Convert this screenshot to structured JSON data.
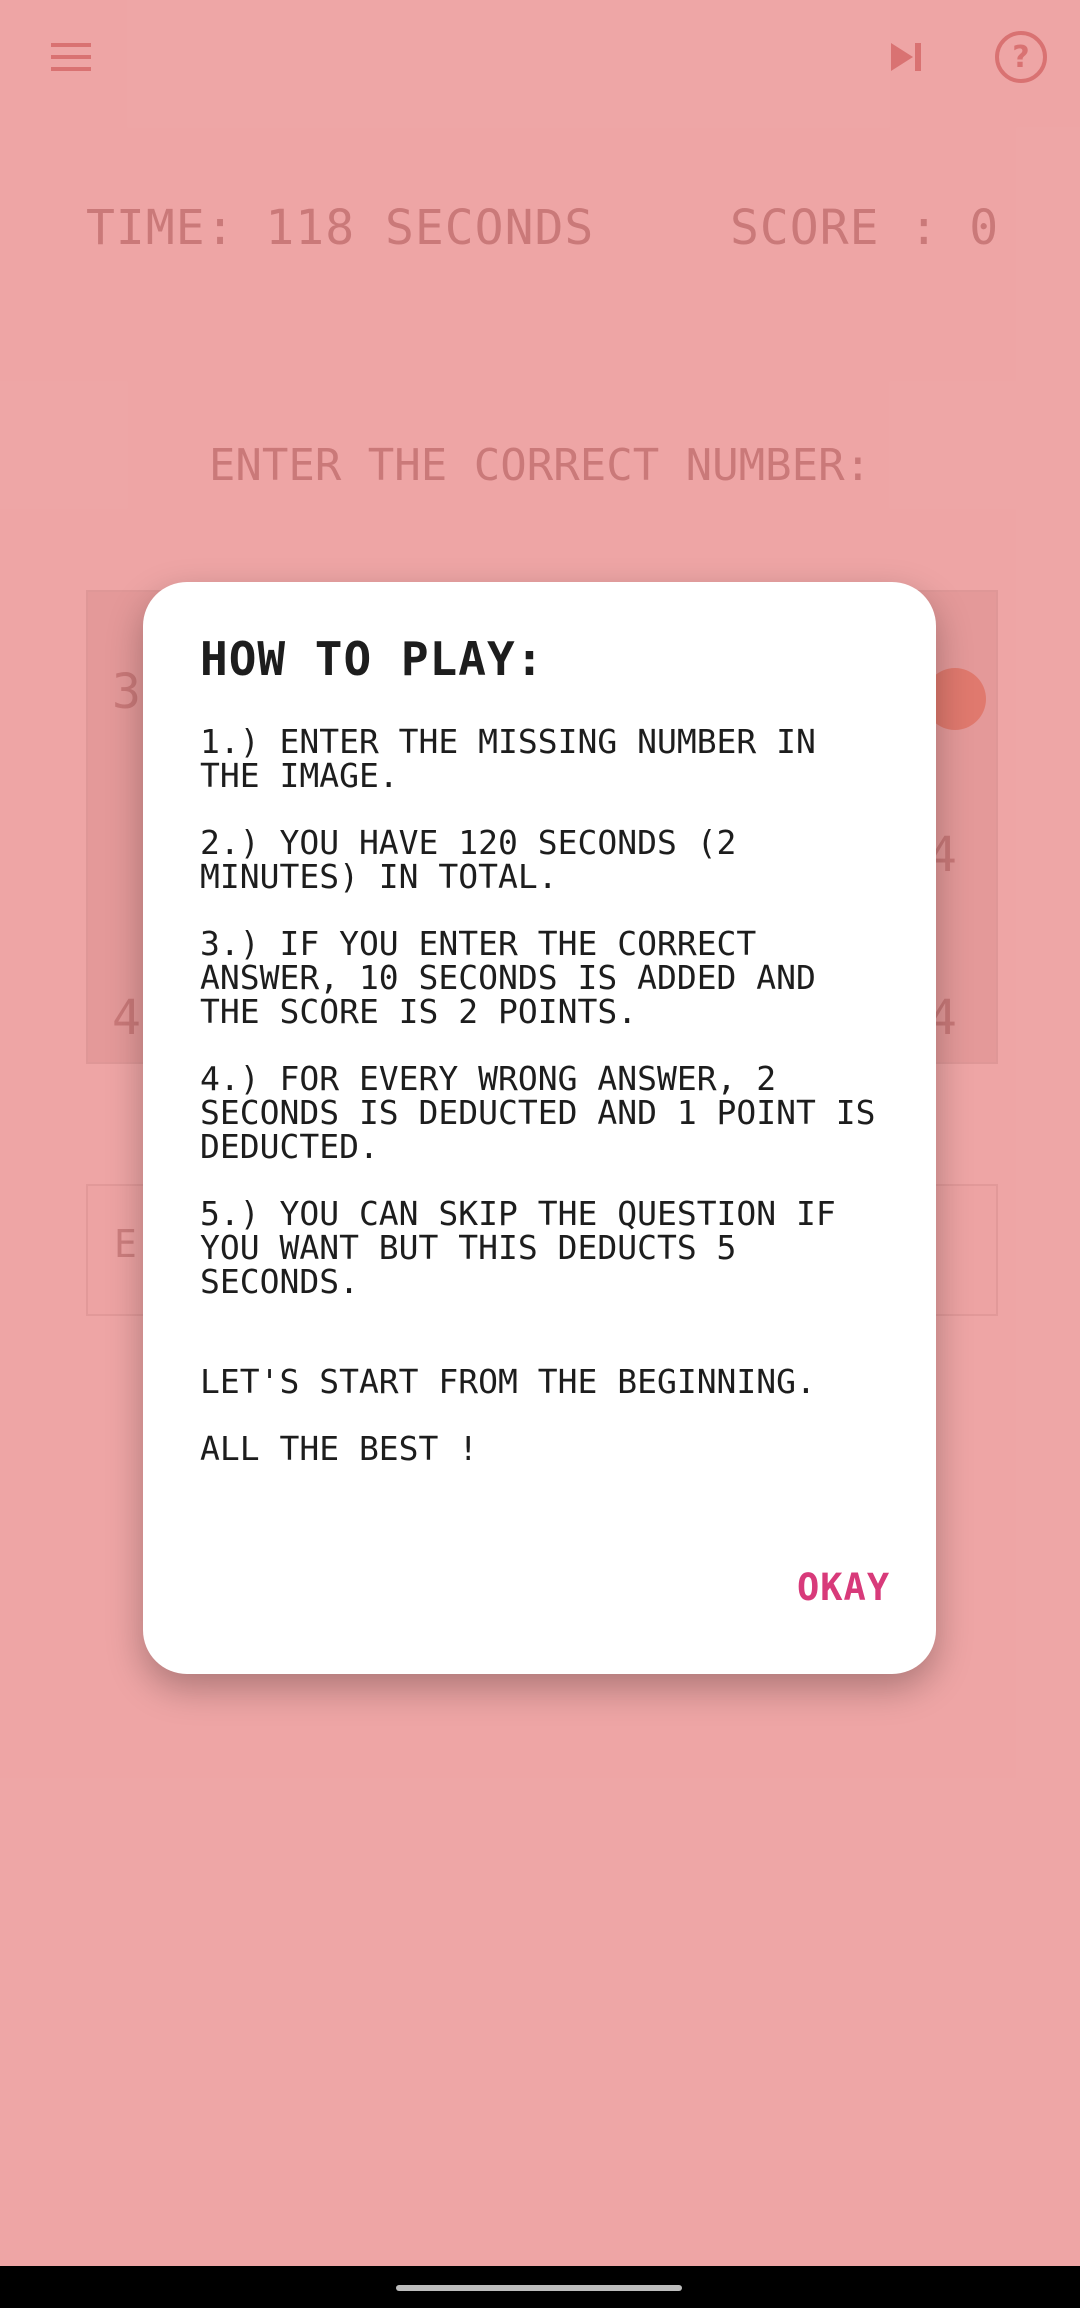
{
  "header": {
    "menu_icon": "hamburger-menu-icon",
    "skip_icon": "skip-next-icon",
    "help_icon": "help-icon",
    "help_glyph": "?"
  },
  "hud": {
    "time": "TIME: 118 SECONDS",
    "score": "SCORE : 0"
  },
  "prompt": "ENTER THE CORRECT NUMBER:",
  "image_numbers": [
    "3",
    "4",
    "4",
    "4"
  ],
  "answer_placeholder": "E",
  "dialog": {
    "title": "HOW TO PLAY:",
    "rules": [
      "1.) ENTER THE MISSING NUMBER IN\nTHE IMAGE.",
      "2.) YOU HAVE 120 SECONDS (2\nMINUTES) IN TOTAL.",
      "3.) IF YOU ENTER THE CORRECT\nANSWER, 10 SECONDS IS ADDED AND\nTHE SCORE IS 2 POINTS.",
      "4.) FOR EVERY WRONG ANSWER, 2\nSECONDS IS DEDUCTED AND 1 POINT IS\nDEDUCTED.",
      "5.) YOU CAN SKIP THE QUESTION IF\nYOU WANT BUT THIS DEDUCTS 5\nSECONDS."
    ],
    "start_line": "LET'S START FROM THE BEGINNING.",
    "best_line": "ALL THE BEST !",
    "okay_label": "OKAY"
  },
  "colors": {
    "background": "#fcc7c7",
    "scrim": "#e39a9a",
    "accent": "#d83a7a",
    "dialog": "#ffffff"
  }
}
